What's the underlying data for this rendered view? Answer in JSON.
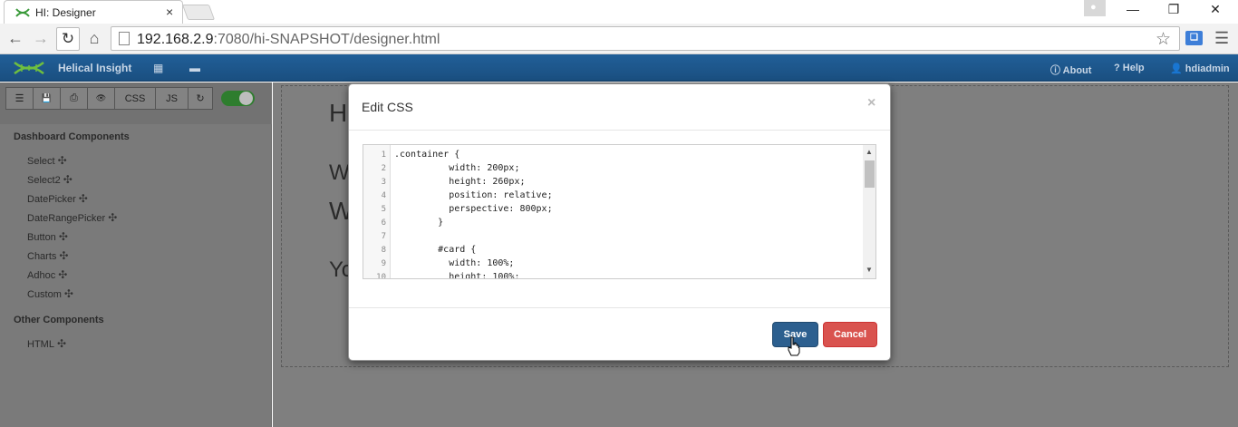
{
  "browser": {
    "tab_title": "HI: Designer",
    "tab_close": "×",
    "url_host": "192.168.2.9",
    "url_rest": ":7080/hi-SNAPSHOT/designer.html",
    "window_user_icon": "user-icon",
    "minimize": "—",
    "restore": "❐",
    "close": "✕"
  },
  "navbar": {
    "brand": "Helical Insight",
    "about": "About",
    "help": "Help",
    "user": "hdiadmin",
    "accent_color": "#1f5a92"
  },
  "sidebar": {
    "toolbar": {
      "list_icon": "☰",
      "save_icon": "💾",
      "print_icon": "⎙",
      "preview_icon": "👁",
      "css_label": "CSS",
      "js_label": "JS",
      "refresh_icon": "↻",
      "toggle_on": true
    },
    "dashboard_heading": "Dashboard Components",
    "dashboard_items": [
      {
        "label": "Select"
      },
      {
        "label": "Select2"
      },
      {
        "label": "DatePicker"
      },
      {
        "label": "DateRangePicker"
      },
      {
        "label": "Button"
      },
      {
        "label": "Charts"
      },
      {
        "label": "Adhoc"
      },
      {
        "label": "Custom"
      }
    ],
    "other_heading": "Other Components",
    "other_items": [
      {
        "label": "HTML"
      }
    ],
    "move_glyph": "✣"
  },
  "canvas": {
    "text_h": "H",
    "text_w1": "W",
    "text_w2": "W",
    "text_yo": "Yo"
  },
  "modal": {
    "title": "Edit CSS",
    "close": "×",
    "save_label": "Save",
    "cancel_label": "Cancel",
    "save_color": "#2c5f8f",
    "cancel_color": "#d9534f",
    "code_lines": [
      {
        "n": "1",
        "text": ".container {"
      },
      {
        "n": "2",
        "text": "          width: 200px;"
      },
      {
        "n": "3",
        "text": "          height: 260px;"
      },
      {
        "n": "4",
        "text": "          position: relative;"
      },
      {
        "n": "5",
        "text": "          perspective: 800px;"
      },
      {
        "n": "6",
        "text": "        }"
      },
      {
        "n": "7",
        "text": ""
      },
      {
        "n": "8",
        "text": "        #card {"
      },
      {
        "n": "9",
        "text": "          width: 100%;"
      },
      {
        "n": "10",
        "text": "          height: 100%;"
      }
    ]
  }
}
